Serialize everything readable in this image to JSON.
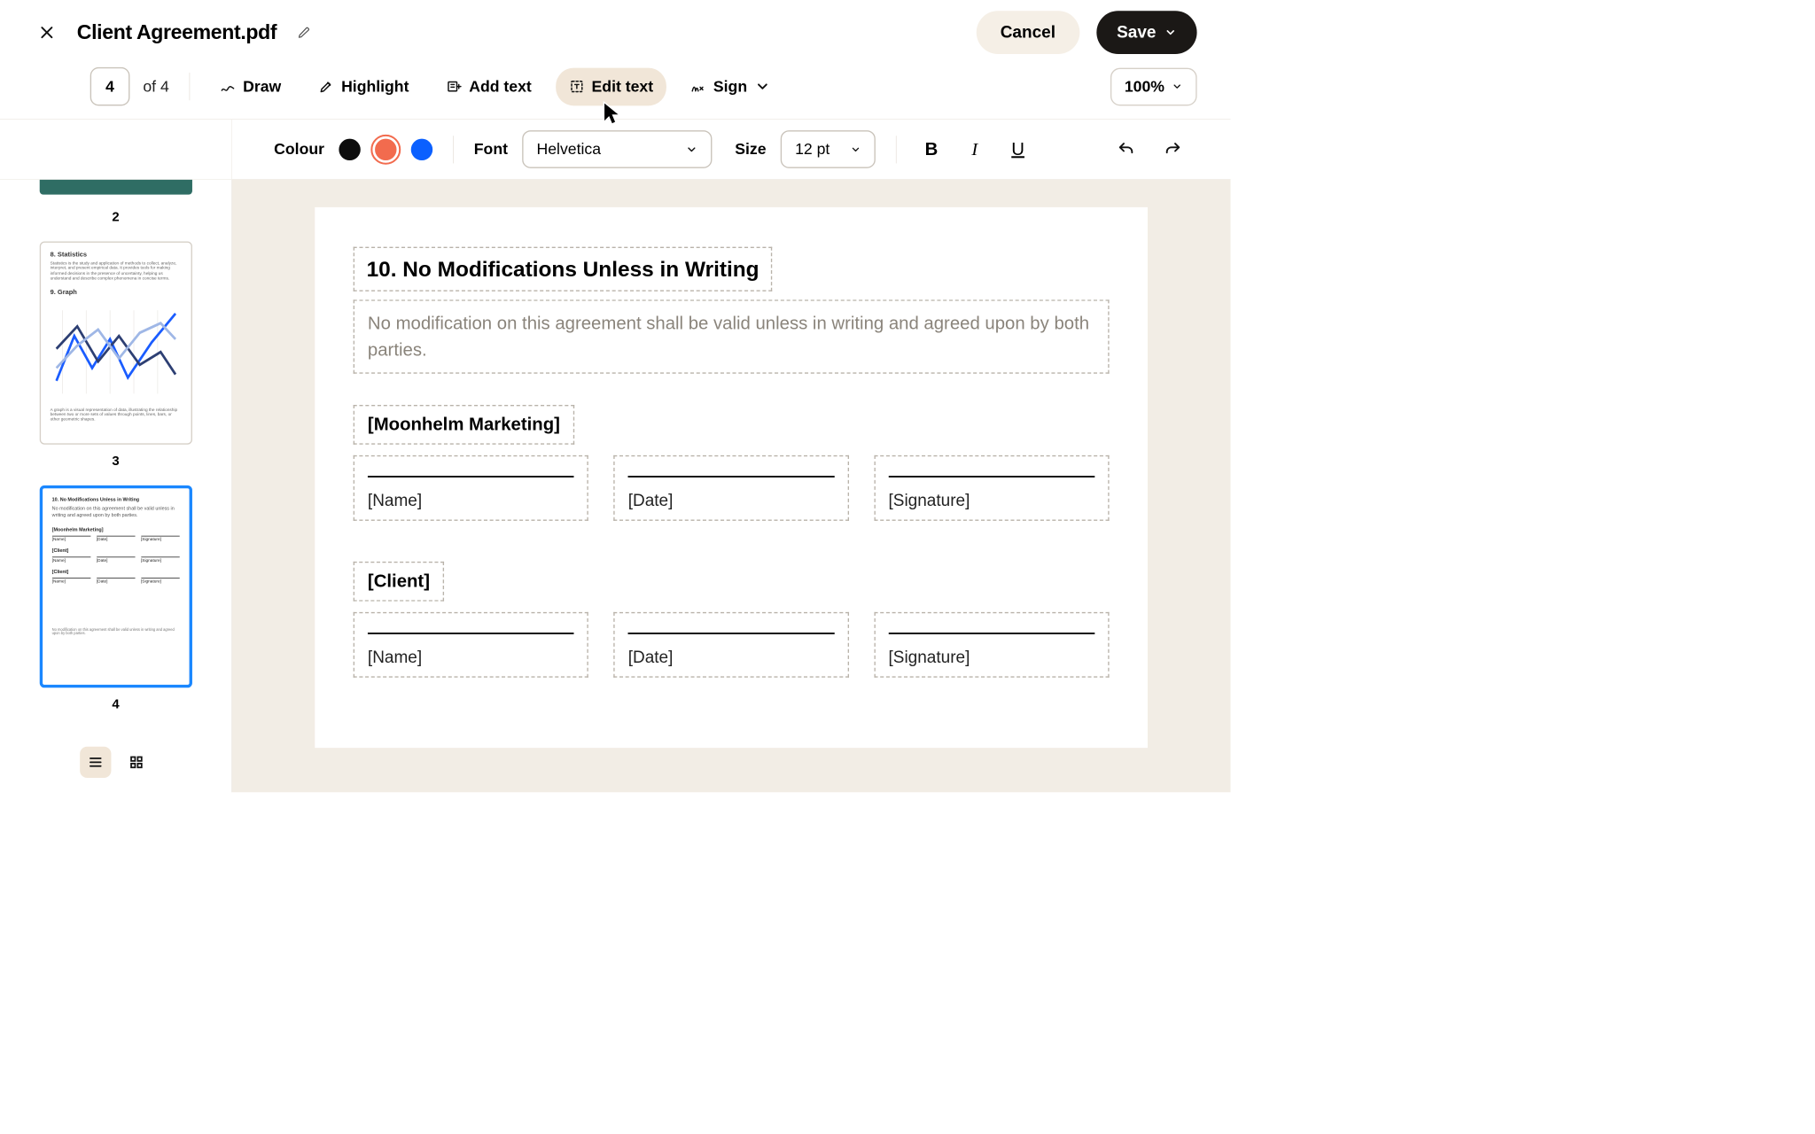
{
  "header": {
    "document_title": "Client Agreement.pdf",
    "cancel_label": "Cancel",
    "save_label": "Save"
  },
  "pager": {
    "current": "4",
    "of_label": "of 4"
  },
  "tools": {
    "draw": "Draw",
    "highlight": "Highlight",
    "add_text": "Add text",
    "edit_text": "Edit text",
    "sign": "Sign"
  },
  "zoom": {
    "value": "100%"
  },
  "format": {
    "colour_label": "Colour",
    "font_label": "Font",
    "font_value": "Helvetica",
    "size_label": "Size",
    "size_value": "12 pt",
    "colors": {
      "black": "#0d0d0d",
      "orange": "#f26b4e",
      "blue": "#0b60ff"
    },
    "selected_color": "orange"
  },
  "thumbs": {
    "page2_num": "2",
    "page3_num": "3",
    "page4_num": "4",
    "p3": {
      "h1": "8. Statistics",
      "p1": "Statistics is the study and application of methods to collect, analyze, interpret, and present empirical data. It provides tools for making informed decisions in the presence of uncertainty, helping us understand and describe complex phenomena in concise terms.",
      "h2": "9. Graph",
      "p2": "A graph is a visual representation of data, illustrating the relationship between two or more sets of values through points, lines, bars, or other geometric shapes."
    },
    "p4": {
      "h": "10. No Modifications Unless in Writing",
      "p": "No modification on this agreement shall be valid unless in writing and agreed upon by both parties.",
      "party1": "[Moonhelm Marketing]",
      "party2": "[Client]",
      "party3": "[Client]",
      "name": "[Name]",
      "date": "[Date]",
      "sig": "[Signature]",
      "foot": "No modification on this agreement shall be valid unless in writing and agreed upon by both parties."
    }
  },
  "page4": {
    "heading": "10. No Modifications Unless in Writing",
    "paragraph": "No modification on this agreement shall be valid unless in writing and agreed upon by both parties.",
    "party1": "[Moonhelm Marketing]",
    "party2": "[Client]",
    "fields": {
      "name": "[Name]",
      "date": "[Date]",
      "signature": "[Signature]"
    }
  }
}
